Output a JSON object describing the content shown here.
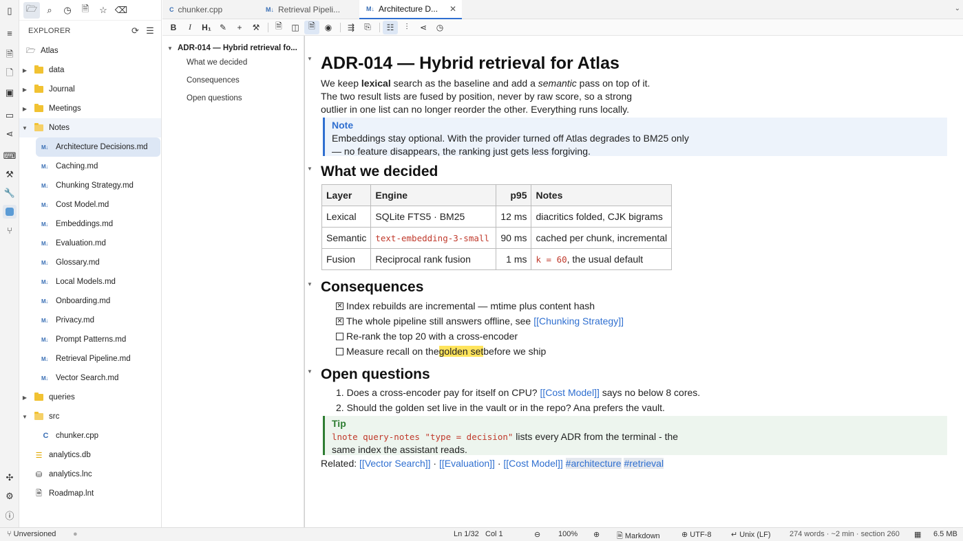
{
  "rail_icons": [
    "sidebar-toggle-icon",
    "menu-icon",
    "new-note-icon",
    "file-icon",
    "save-icon",
    "window-icon",
    "share-icon",
    "terminal-icon",
    "wand-icon",
    "wrench-icon",
    "app-icon",
    "branch-icon",
    "plugin-icon",
    "settings-icon",
    "help-icon"
  ],
  "sidebar": {
    "title": "EXPLORER",
    "tree": [
      {
        "label": "Atlas",
        "type": "root"
      },
      {
        "label": "data",
        "type": "folder"
      },
      {
        "label": "Journal",
        "type": "folder"
      },
      {
        "label": "Meetings",
        "type": "folder"
      },
      {
        "label": "Notes",
        "type": "folder-open"
      },
      {
        "label": "Architecture Decisions.md",
        "type": "md",
        "selected": true
      },
      {
        "label": "Caching.md",
        "type": "md"
      },
      {
        "label": "Chunking Strategy.md",
        "type": "md"
      },
      {
        "label": "Cost Model.md",
        "type": "md"
      },
      {
        "label": "Embeddings.md",
        "type": "md"
      },
      {
        "label": "Evaluation.md",
        "type": "md"
      },
      {
        "label": "Glossary.md",
        "type": "md"
      },
      {
        "label": "Local Models.md",
        "type": "md"
      },
      {
        "label": "Onboarding.md",
        "type": "md"
      },
      {
        "label": "Privacy.md",
        "type": "md"
      },
      {
        "label": "Prompt Patterns.md",
        "type": "md"
      },
      {
        "label": "Retrieval Pipeline.md",
        "type": "md"
      },
      {
        "label": "Vector Search.md",
        "type": "md"
      },
      {
        "label": "queries",
        "type": "folder"
      },
      {
        "label": "src",
        "type": "folder-open"
      },
      {
        "label": "chunker.cpp",
        "type": "cpp"
      },
      {
        "label": "analytics.db",
        "type": "db"
      },
      {
        "label": "analytics.lnc",
        "type": "lnc"
      },
      {
        "label": "Roadmap.lnt",
        "type": "lnt"
      }
    ]
  },
  "tabs": [
    {
      "label": "chunker.cpp"
    },
    {
      "label": "Retrieval Pipeli..."
    },
    {
      "label": "Architecture D...",
      "active": true
    }
  ],
  "outline": {
    "title": "ADR-014 — Hybrid retrieval fo...",
    "items": [
      "What we decided",
      "Consequences",
      "Open questions"
    ]
  },
  "doc": {
    "h1": "ADR-014 — Hybrid retrieval for Atlas",
    "intro": {
      "p1": "We keep ",
      "b": "lexical",
      "p2": " search as the baseline and add a ",
      "i": "semantic",
      "p3": " pass on top of it. The two result lists are fused by position, never by raw score, so a strong outlier in one list can no longer reorder the other. Everything runs locally."
    },
    "note": {
      "title": "Note",
      "body": "Embeddings stay optional. With the provider turned off Atlas degrades to BM25 only — no feature disappears, the ranking just gets less forgiving."
    },
    "h2_decided": "What we decided",
    "table": {
      "headers": [
        "Layer",
        "Engine",
        "p95",
        "Notes"
      ],
      "r1": [
        "Lexical",
        "SQLite FTS5 · BM25",
        "12 ms",
        "diacritics folded, CJK bigrams"
      ],
      "r2": [
        "Semantic",
        "text-embedding-3-small",
        "90 ms",
        "cached per chunk, incremental"
      ],
      "r3": [
        "Fusion",
        "Reciprocal rank fusion",
        "1 ms",
        "k = 60",
        ", the usual default"
      ]
    },
    "h2_cons": "Consequences",
    "checks": {
      "c1": "Index rebuilds are incremental — mtime plus content hash",
      "c2": "The whole pipeline still answers offline, see ",
      "c2link": "[[Chunking Strategy]]",
      "c3": "Re-rank the top 20 with a cross-encoder",
      "c4a": "Measure recall on the ",
      "c4hl": "golden set",
      "c4b": " before we ship",
      "check_mark": "✕"
    },
    "h2_open": "Open questions",
    "list": {
      "n1": "1.",
      "l1a": "Does a cross-encoder pay for itself on CPU? ",
      "l1link": "[[Cost Model]]",
      "l1b": " says no below 8 cores.",
      "n2": "2.",
      "l2": "Should the golden set live in the vault or in the repo? Ana prefers the vault."
    },
    "tip": {
      "title": "Tip",
      "code": "lnote query-notes \"type = decision\"",
      "body": " lists every ADR from the terminal - the same index the assistant reads."
    },
    "related": {
      "label": "Related: ",
      "l1": "[[Vector Search]]",
      "sep": " · ",
      "l2": "[[Evaluation]]",
      "l3": "[[Cost Model]]",
      "t1": "#architecture",
      "t2": "#retrieval"
    }
  },
  "status": {
    "vcs": "Unversioned",
    "pos": "Ln 1/32",
    "col": "Col 1",
    "zoom": "100%",
    "mode": "Markdown",
    "enc": "UTF-8",
    "eol": "Unix (LF)",
    "stats": "274 words · ~2 min · section 260",
    "mem": "6.5 MB"
  }
}
